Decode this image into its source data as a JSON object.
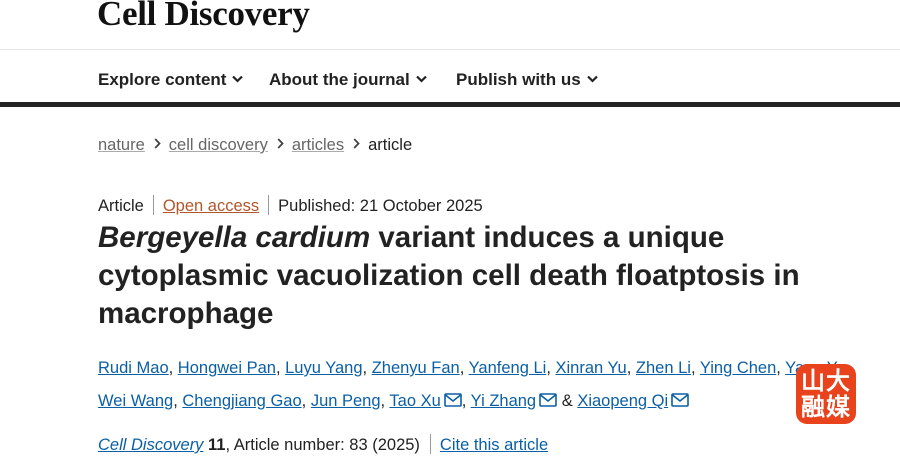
{
  "brand": {
    "name": "Cell Discovery"
  },
  "nav": {
    "items": [
      {
        "label": "Explore content"
      },
      {
        "label": "About the journal"
      },
      {
        "label": "Publish with us"
      }
    ]
  },
  "breadcrumb": {
    "items": [
      "nature",
      "cell discovery",
      "articles"
    ],
    "current": "article"
  },
  "article_meta": {
    "type": "Article",
    "access": "Open access",
    "published": "Published: 21 October 2025"
  },
  "title": {
    "italic_part": "Bergeyella cardium",
    "rest": " variant induces a unique cytoplasmic vacuolization cell death floatptosis in macrophage"
  },
  "authors": [
    "Rudi Mao",
    "Hongwei Pan",
    "Luyu Yang",
    "Zhenyu Fan",
    "Yanfeng Li",
    "Xinran Yu",
    "Zhen Li",
    "Ying Chen",
    "Yang Yu",
    "Wei Wang",
    "Chengjiang Gao",
    "Jun Peng",
    "Tao Xu",
    "Yi Zhang",
    "Xiaopeng Qi"
  ],
  "authors_joiner": "&",
  "citation": {
    "journal": "Cell Discovery",
    "volume": "11",
    "article_number": ", Article number: 83 (2025)",
    "cite_label": "Cite this article"
  },
  "watermark": {
    "text": "山大融媒"
  },
  "colors": {
    "link": "#0b5fa5",
    "open_access": "#b1572b",
    "nav_rule": "#222222",
    "watermark_bg": "#e8431d"
  },
  "icons": [
    "chevron-down-icon",
    "chevron-right-icon",
    "mail-icon"
  ]
}
